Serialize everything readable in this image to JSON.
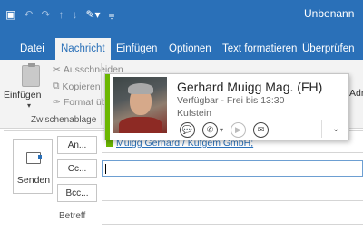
{
  "window": {
    "title": "Unbenann",
    "qat": {
      "save_icon": "save-icon",
      "undo_icon": "undo-icon",
      "redo_icon": "redo-icon",
      "up_icon": "arrow-up-icon",
      "down_icon": "arrow-down-icon",
      "paint_icon": "format-painter-icon",
      "customize_icon": "customize-qat-icon"
    }
  },
  "tabs": [
    "Datei",
    "Nachricht",
    "Einfügen",
    "Optionen",
    "Text formatieren",
    "Überprüfen"
  ],
  "active_tab": "Nachricht",
  "ribbon": {
    "clipboard": {
      "paste_label": "Einfügen",
      "cut_label": "Ausschneiden",
      "copy_label": "Kopieren",
      "format_label": "Format übertragen",
      "group_label": "Zwischenablage"
    },
    "right_partial_label": "Adr"
  },
  "contact_card": {
    "name": "Gerhard Muigg Mag. (FH)",
    "availability": "Verfügbar - Frei bis 13:30",
    "location": "Kufstein",
    "presence_color": "#6bb700",
    "actions": [
      {
        "icon": "chat-icon",
        "glyph": "💬",
        "enabled": true
      },
      {
        "icon": "phone-icon",
        "glyph": "✆",
        "enabled": true
      },
      {
        "icon": "video-icon",
        "glyph": "▶",
        "enabled": false
      },
      {
        "icon": "email-icon",
        "glyph": "✉",
        "enabled": true
      }
    ],
    "expand_icon": "chevron-down-icon"
  },
  "compose": {
    "send_label": "Senden",
    "to_label": "An...",
    "cc_label": "Cc...",
    "bcc_label": "Bcc...",
    "subject_label": "Betreff",
    "to_value": "Muigg Gerhard / Kufgem GmbH;"
  },
  "colors": {
    "accent": "#2a70b8",
    "ribbon_bg": "#f3f3f3"
  }
}
